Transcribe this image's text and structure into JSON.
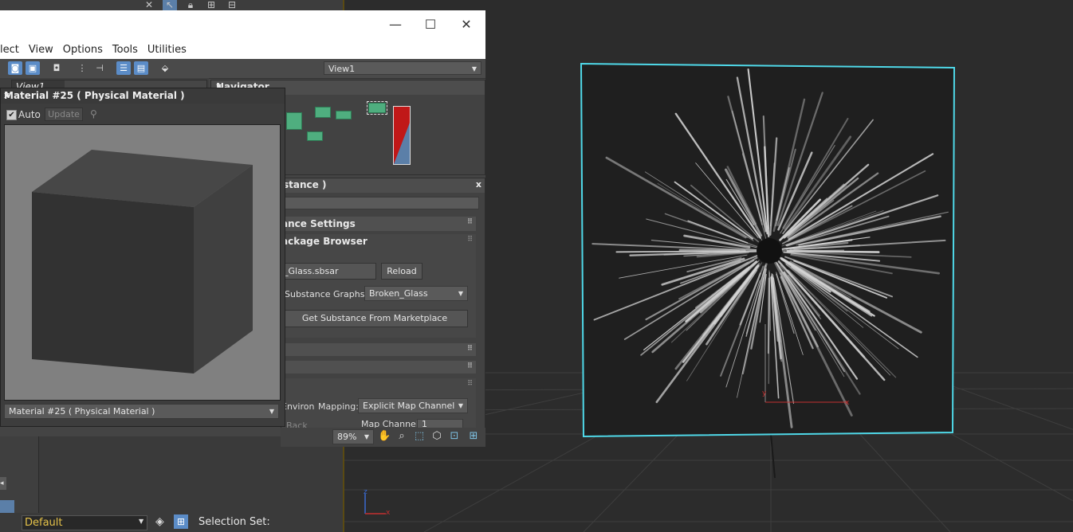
{
  "top_icons": [
    "close-icon",
    "select-icon",
    "lock-icon",
    "hierarchy-icon",
    "link-icon"
  ],
  "slate": {
    "menu": [
      "lect",
      "View",
      "Options",
      "Tools",
      "Utilities"
    ],
    "view_select": "View1",
    "tab_label": "View1",
    "window_buttons": {
      "minimize": "—",
      "maximize": "☐",
      "close": "✕"
    }
  },
  "navigator": {
    "title": "Navigator",
    "close": "x"
  },
  "substance": {
    "title": "stance )",
    "close": "x",
    "rollouts": {
      "settings": "ance Settings",
      "browser": "ackage Browser"
    },
    "package_file": "_Glass.sbsar",
    "reload_label": "Reload",
    "graphs_label": "Substance Graphs:",
    "graph_value": "Broken_Glass",
    "marketplace_label": "Get Substance From Marketplace",
    "environ_label": "Environ",
    "mapping_label": "Mapping:",
    "mapping_value": "Explicit Map Channel",
    "back_label": "Back",
    "map_channel_label": "Map Channel:",
    "map_channel_value": "1"
  },
  "status": {
    "zoom": "89%"
  },
  "material_preview": {
    "title": "Material #25  ( Physical Material )",
    "close": "x",
    "auto_label": "Auto",
    "auto_checked": "✔",
    "update_label": "Update",
    "material_select": "Material #25  ( Physical Material )"
  },
  "bottom": {
    "layer_value": "Default",
    "selection_set_label": "Selection Set:"
  },
  "viewport": {
    "axis_y": "y",
    "axis_x": "x",
    "gizmo_z": "z",
    "gizmo_x": "x"
  },
  "colors": {
    "selection_outline": "#4fd8e8",
    "node_green": "#4fae7f",
    "tool_blue": "#5b8cc7",
    "layer_text": "#e6c34a"
  }
}
